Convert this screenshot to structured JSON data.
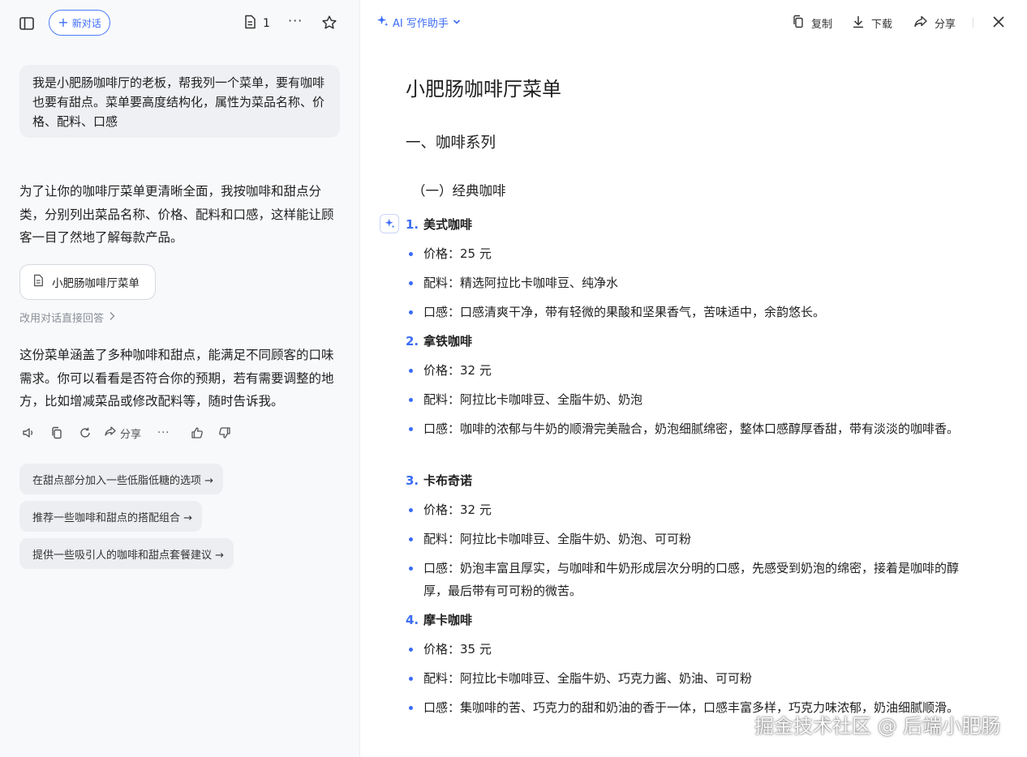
{
  "left_panel": {
    "new_chat_label": "新对话",
    "doc_count": "1",
    "user_message": "我是小肥肠咖啡厅的老板，帮我列一个菜单，要有咖啡也要有甜点。菜单要高度结构化，属性为菜品名称、价格、配料、口感",
    "ai_intro": "为了让你的咖啡厅菜单更清晰全面，我按咖啡和甜点分类，分别列出菜品名称、价格、配料和口感，这样能让顾客一目了然地了解每款产品。",
    "doc_card_title": "小肥肠咖啡厅菜单",
    "switch_link": "改用对话直接回答",
    "ai_outro": "这份菜单涵盖了多种咖啡和甜点，能满足不同顾客的口味需求。你可以看看是否符合你的预期，若有需要调整的地方，比如增减菜品或修改配料等，随时告诉我。",
    "share_label": "分享",
    "suggestions": [
      "在甜点部分加入一些低脂低糖的选项 →",
      "推荐一些咖啡和甜点的搭配组合 →",
      "提供一些吸引人的咖啡和甜点套餐建议 →"
    ]
  },
  "right_panel": {
    "assistant_label": "AI 写作助手",
    "copy_label": "复制",
    "download_label": "下载",
    "share_label": "分享",
    "doc_title": "小肥肠咖啡厅菜单",
    "section_title": "一、咖啡系列",
    "subsection_title": "（一）经典咖啡",
    "items": [
      {
        "num": "1.",
        "name": "美式咖啡",
        "price": "价格：25 元",
        "ingredients": "配料：精选阿拉比卡咖啡豆、纯净水",
        "taste": "口感：口感清爽干净，带有轻微的果酸和坚果香气，苦味适中，余韵悠长。"
      },
      {
        "num": "2.",
        "name": "拿铁咖啡",
        "price": "价格：32 元",
        "ingredients": "配料：阿拉比卡咖啡豆、全脂牛奶、奶泡",
        "taste": "口感：咖啡的浓郁与牛奶的顺滑完美融合，奶泡细腻绵密，整体口感醇厚香甜，带有淡淡的咖啡香。"
      },
      {
        "num": "3.",
        "name": "卡布奇诺",
        "price": "价格：32 元",
        "ingredients": "配料：阿拉比卡咖啡豆、全脂牛奶、奶泡、可可粉",
        "taste": "口感：奶泡丰富且厚实，与咖啡和牛奶形成层次分明的口感，先感受到奶泡的绵密，接着是咖啡的醇厚，最后带有可可粉的微苦。"
      },
      {
        "num": "4.",
        "name": "摩卡咖啡",
        "price": "价格：35 元",
        "ingredients": "配料：阿拉比卡咖啡豆、全脂牛奶、巧克力酱、奶油、可可粉",
        "taste": "口感：集咖啡的苦、巧克力的甜和奶油的香于一体，口感丰富多样，巧克力味浓郁，奶油细腻顺滑。"
      }
    ]
  },
  "watermark": "掘金技术社区 @ 后端小肥肠",
  "colors": {
    "accent": "#3b6cf6",
    "left_bg": "#f8f9fb",
    "bubble_bg": "#eef0f3"
  }
}
